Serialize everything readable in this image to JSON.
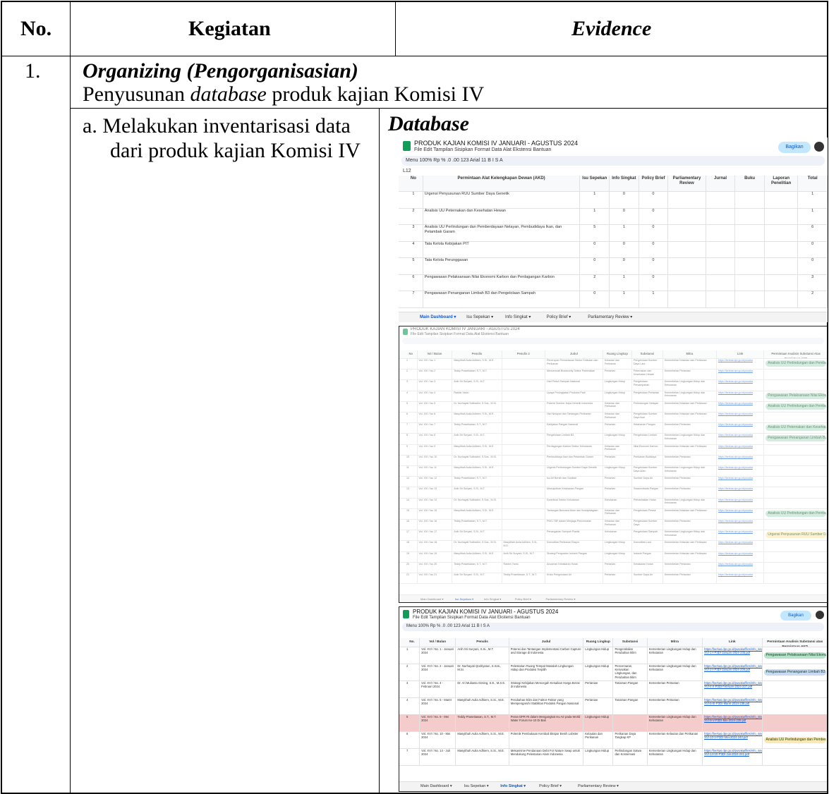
{
  "table": {
    "headers": {
      "no": "No.",
      "kegiatan": "Kegiatan",
      "evidence": "Evidence"
    },
    "row1": {
      "no": "1.",
      "title": "Organizing (Pengorganisasian)",
      "subtitle_pre": "Penyusunan ",
      "subtitle_em": "database",
      "subtitle_post": " produk kajian Komisi IV"
    },
    "item_a": {
      "line1": "a. Melakukan inventarisasi data",
      "line2": "dari produk kajian Komisi IV",
      "evidence_title": "Database"
    }
  },
  "spreadsheet": {
    "doc_title": "PRODUK KAJIAN KOMISI IV JANUARI - AGUSTUS 2024",
    "menu": "File  Edit  Tampilan  Sisipkan  Format  Data  Alat  Ekstensi  Bantuan",
    "toolbar": "Menu    100%    Rp  %  .0  .00  123    Arial    11    B  I  S  A",
    "share_label": "Bagikan",
    "cell_ref": "L12",
    "tabs": [
      "Main Dashboard",
      "Isu Sepekan",
      "Info Singkat",
      "Policy Brief",
      "Parliamentary Review"
    ],
    "dashboard": {
      "columns": [
        "No",
        "Permintaan Alat Kelengkapan Dewan (AKD)",
        "Isu Sepekan",
        "Info Singkat",
        "Policy Brief",
        "Parliamentary Review",
        "Jurnal",
        "Buku",
        "Laporan Penelitian",
        "Total"
      ],
      "rows": [
        [
          "1",
          "Urgensi Penyusunan RUU Sumber Daya Genetik",
          "1",
          "0",
          "0",
          "",
          "",
          "",
          "",
          "1"
        ],
        [
          "2",
          "Analisis UU Peternakan dan Kesehatan Hewan",
          "1",
          "0",
          "0",
          "",
          "",
          "",
          "",
          "1"
        ],
        [
          "3",
          "Analisis UU Perlindungan dan Pemberdayaan Nelayan, Pembudidaya Ikan, dan Petambak Garam",
          "5",
          "1",
          "0",
          "",
          "",
          "",
          "",
          "6"
        ],
        [
          "4",
          "Tata Kelola Kebijakan PIT",
          "0",
          "0",
          "0",
          "",
          "",
          "",
          "",
          "0"
        ],
        [
          "5",
          "Tata Kelola Perunggasan",
          "0",
          "0",
          "0",
          "",
          "",
          "",
          "",
          "0"
        ],
        [
          "6",
          "Pengawasan Pelaksanaan Nilai Ekonomi Karbon dan Perdagangan Karbon",
          "2",
          "1",
          "0",
          "",
          "",
          "",
          "",
          "3"
        ],
        [
          "7",
          "Pengawasan Penanganan Limbah B3 dan Pengelolaan Sampah",
          "0",
          "1",
          "1",
          "",
          "",
          "",
          "",
          "2"
        ]
      ]
    },
    "isu": {
      "columns": [
        "No",
        "Vol / Bulan",
        "Penulis",
        "Penulis 2",
        "Judul",
        "Ruang Lingkup",
        "Substansi",
        "Mitra",
        "Link",
        "Permintaan Analisis Substansi Atas Permintaan AKD"
      ],
      "rows": [
        [
          "1",
          "Vol. XVI / Isu 1",
          "Masyithah Aulia Adhiem, S.Si., M.E.",
          "",
          "Penerapan Pemantauan Sektor Kelautan dan Perikanan",
          "Kelautan dan Perikanan",
          "Pengelolaan Sumber Daya Laut",
          "Kementerian Kelautan dan Perikanan",
          "https://berkas.dpr.go.id/pusaka",
          "Analisis UU Perlindungan dan Pemberdayaan"
        ],
        [
          "2",
          "Vol. XVI / Isu 2",
          "Teddy Prasetiawan, S.T., M.T.",
          "",
          "Mencermati Biosecurity Sektor Peternakan",
          "Pertanian",
          "Peternakan dan Kesehatan Hewan",
          "Kementerian Pertanian",
          "https://berkas.dpr.go.id/pusaka",
          ""
        ],
        [
          "3",
          "Vol. XVI / Isu 3",
          "Anih Sri Suryani, S.Si., M.T.",
          "",
          "Hari Peduli Sampah Nasional",
          "Lingkungan Hidup",
          "Pengelolaan Persampahan",
          "Kementerian Lingkungan Hidup dan Kehutanan",
          "https://berkas.dpr.go.id/pusaka",
          ""
        ],
        [
          "4",
          "Vol. XVI / Isu 4",
          "Rasbin Yanto",
          "",
          "Upaya Peningkatan Produksi Padi",
          "Lingkungan Hidup",
          "Pengelolaan Pertanian",
          "Kementerian Lingkungan Hidup dan Kehutanan",
          "https://berkas.dpr.go.id/pusaka",
          "Pengawasan Pelaksanaan Nilai Ekonomi"
        ],
        [
          "5",
          "Vol. XVI / Isu 5",
          "Dr. Nurhayati Solihadini, S.Sos., M.Si.",
          "",
          "Potensi Sumber Daya Genetik Indonesia",
          "Kelautan dan Perikanan",
          "Perlindungan Nelayan",
          "Kementerian Kelautan dan Perikanan",
          "https://berkas.dpr.go.id/pusaka",
          "Analisis UU Perlindungan dan Pemberdayaan"
        ],
        [
          "6",
          "Vol. XVI / Isu 6",
          "Masyithah Aulia Adhiem, S.Si., M.E.",
          "",
          "Hari Nelayan dan Tantangan Perikanan",
          "Kelautan dan Perikanan",
          "Pengelolaan Sumber Daya Ikan",
          "Kementerian Kelautan dan Perikanan",
          "https://berkas.dpr.go.id/pusaka",
          ""
        ],
        [
          "7",
          "Vol. XVI / Isu 7",
          "Teddy Prasetiawan, S.T., M.T.",
          "",
          "Kebijakan Pangan Nasional",
          "Pertanian",
          "Ketahanan Pangan",
          "Kementerian Pertanian",
          "https://berkas.dpr.go.id/pusaka",
          "Analisis UU Peternakan dan Kesehatan"
        ],
        [
          "8",
          "Vol. XVI / Isu 8",
          "Anih Sri Suryani, S.Si., M.T.",
          "",
          "Pengelolaan Limbah B3",
          "Lingkungan Hidup",
          "Pengelolaan Limbah",
          "Kementerian Lingkungan Hidup dan Kehutanan",
          "https://berkas.dpr.go.id/pusaka",
          "Pengawasan Penanganan Limbah B3"
        ],
        [
          "9",
          "Vol. XVI / Isu 9",
          "Masyithah Aulia Adhiem, S.Si., M.E.",
          "",
          "Perdagangan Karbon Sektor Kehutanan",
          "Kelautan dan Perikanan",
          "Nilai Ekonomi Karbon",
          "Kementerian Kelautan dan Perikanan",
          "https://berkas.dpr.go.id/pusaka",
          ""
        ],
        [
          "10",
          "Vol. XVI / Isu 10",
          "Dr. Nurhayati Solihadini, S.Sos., M.Si.",
          "",
          "Pembudidaya Ikan dan Petambak Garam",
          "Pertanian",
          "Perikanan Budidaya",
          "Kementerian Pertanian",
          "https://berkas.dpr.go.id/pusaka",
          ""
        ],
        [
          "11",
          "Vol. XVI / Isu 11",
          "Masyithah Aulia Adhiem, S.Si., M.E.",
          "",
          "Urgensi Perlindungan Sumber Daya Genetik",
          "Lingkungan Hidup",
          "Pengelolaan Sumber Daya Alam",
          "Kementerian Lingkungan Hidup dan Kehutanan",
          "https://berkas.dpr.go.id/pusaka",
          ""
        ],
        [
          "12",
          "Vol. XVI / Isu 12",
          "Teddy Prasetiawan, S.T., M.T.",
          "",
          "Isu Air Bersih dan Sanitasi",
          "Pertanian",
          "Sumber Daya Air",
          "Kementerian Pertanian",
          "https://berkas.dpr.go.id/pusaka",
          ""
        ],
        [
          "13",
          "Vol. XVI / Isu 13",
          "Anih Sri Suryani, S.Si., M.T.",
          "",
          "Mewujudkan Ketahanan Pangan",
          "Pertanian",
          "Swasembada Pangan",
          "Kementerian Pertanian",
          "https://berkas.dpr.go.id/pusaka",
          ""
        ],
        [
          "14",
          "Vol. XVI / Isu 14",
          "Dr. Nurhayati Solihadini, S.Sos., M.Si.",
          "",
          "Kontribusi Sektor Kehutanan",
          "Kehutanan",
          "Pemanfaatan Hutan",
          "Kementerian Lingkungan Hidup dan Kehutanan",
          "https://berkas.dpr.go.id/pusaka",
          ""
        ],
        [
          "15",
          "Vol. XVI / Isu 15",
          "Masyithah Aulia Adhiem, S.Si., M.E.",
          "",
          "Tantangan Bencana Alam dan Kesiapsiagaan",
          "Kelautan dan Perikanan",
          "Pengelolaan Pesisir",
          "Kementerian Kelautan dan Perikanan",
          "https://berkas.dpr.go.id/pusaka",
          "Analisis UU Perlindungan dan Pemberdayaan"
        ],
        [
          "16",
          "Vol. XVI / Isu 16",
          "Teddy Prasetiawan, S.T., M.T.",
          "",
          "PMO-TBF dalam Menjaga Pencemaran",
          "Kelautan dan Perikanan",
          "Pengelolaan Sumber Daya",
          "Kementerian Pertanian",
          "https://berkas.dpr.go.id/pusaka",
          ""
        ],
        [
          "17",
          "Vol. XVI / Isu 17",
          "Anih Sri Suryani, S.Si., M.T.",
          "",
          "Penanganan Sampah Plastik",
          "Kehutanan",
          "Pengelolaan Sampah",
          "Kementerian Lingkungan Hidup dan Kehutanan",
          "https://berkas.dpr.go.id/pusaka",
          "Urgensi Penyusunan RUU Sumber Daya"
        ],
        [
          "18",
          "Vol. XVI / Isu 18",
          "Dr. Nurhayati Solihadini, S.Sos., M.Si.",
          "Masyithah Aulia Adhiem, S.Si., M.E.",
          "Komoditas Perikanan Ekspor",
          "Lingkungan Hidup",
          "Komoditas Laut",
          "Kementerian Kelautan dan Perikanan",
          "https://berkas.dpr.go.id/pusaka",
          ""
        ],
        [
          "19",
          "Vol. XVI / Isu 19",
          "Masyithah Aulia Adhiem, S.Si., M.E.",
          "Anih Sri Suryani, S.Si., M.T.",
          "Strategi Penguatan Industri Pangan",
          "Lingkungan Hidup",
          "Industri Pangan",
          "Kementerian Kelautan dan Perikanan",
          "https://berkas.dpr.go.id/pusaka",
          ""
        ],
        [
          "20",
          "Vol. XVI / Isu 20",
          "Teddy Prasetiawan, S.T., M.T.",
          "Rasbin Yanto",
          "Ancaman Kebakaran Hutan",
          "Pertanian",
          "Kebakaran Hutan",
          "Kementerian Pertanian",
          "https://berkas.dpr.go.id/pusaka",
          ""
        ],
        [
          "21",
          "Vol. XVI / Isu 21",
          "Anih Sri Suryani, S.Si., M.T.",
          "Teddy Prasetiawan, S.T., M.T.",
          "Krisis Pengelolaan Air",
          "Pertanian",
          "Sumber Daya Air",
          "Kementerian Pertanian",
          "https://berkas.dpr.go.id/pusaka",
          ""
        ]
      ]
    },
    "info": {
      "columns": [
        "No.",
        "Vol / Bulan",
        "Penulis",
        "Judul",
        "Ruang Lingkup",
        "Substansi",
        "Mitra",
        "Link",
        "Permintaan Analisis Substansi atas Permintaan AKD"
      ],
      "rows": [
        [
          "1",
          "Vol. XVI / No. 1 - Januari 2024",
          "Anih Sri Suryani, S.Si., M.T.",
          "Potensi dan Tantangan Implementasi Carbon Capture and Storage di Indonesia",
          "Lingkungan Hidup",
          "Pengendalian Perubahan Iklim",
          "Kementerian Lingkungan Hidup dan Kehutanan",
          "https://berkas.dpr.go.id/pusaka/files/info_singkat/Info%20Singkat-XVI-1-I-P3DI-Januari-2024-235.pdf",
          "Pengawasan Pelaksanaan Nilai Ekonomi Karbon"
        ],
        [
          "2",
          "Vol. XVI / No. 2 - Januari 2024",
          "Dr. Nurhayati Qodriyatun, S.Sos., M.Si.",
          "Pelestarian Ruang Tempat Masalah Lingkungan Hidup dan Produksi Terpilih",
          "Lingkungan Hidup",
          "Pencemaran, Kerusakan Lingkungan, dan Perubahan Iklim",
          "Kementerian Lingkungan Hidup dan Kehutanan",
          "https://berkas.dpr.go.id/pusaka/files/info_singkat/Info%20Singkat-XVI-2-I-P3DI-Januari-2024-236.pdf",
          "Pengawasan Penanganan Limbah B3 dan"
        ],
        [
          "3",
          "Vol. XVI / No. 4 - Februari 2024",
          "Dr. Ari Mulianta Ginting, S.E., M.S.E.",
          "Strategi Kebijakan Mencegah Kenaikan Harga Beras di Indonesia",
          "Pertanian",
          "Tanaman Pangan",
          "Kementerian Pertanian",
          "https://berkas.dpr.go.id/pusaka/files/info_singkat/Info%20Singkat-XVI-4-II-P3DI-Februari-2024-237.pdf",
          ""
        ],
        [
          "4",
          "Vol. XVI / No. 5 - Maret 2024",
          "Masyithah Aulia Adhiem, S.Si., M.E.",
          "Perubahan Iklim dan Faktor-Faktor yang Mempengaruhi Stabilitas Produksi Pangan Nasional",
          "Pertanian",
          "Tanaman Pangan",
          "Kementerian Pertanian",
          "https://berkas.dpr.go.id/pusaka/files/info_singkat/Info%20Singkat-XVI-5-III-P3DI-Maret-2024-238.pdf",
          ""
        ],
        [
          "5",
          "Vol. XVI / No. 9 - Mei 2024",
          "Teddy Prasetiawan, S.T., M.T.",
          "Peran DPR RI dalam Mengangkat Isu Air pada World Water Forum Ke-10 Di Bali",
          "Lingkungan Hidup",
          "",
          "Kementerian Lingkungan Hidup dan Kehutanan",
          "https://berkas.dpr.go.id/pusaka/files/info_singkat/Info%20Singkat-XVI-9-V-P3DI-Mei-2024-239.pdf",
          ""
        ],
        [
          "6",
          "Vol. XVI / No. 10 - Mei 2024",
          "Masyithah Aulia Adhiem, S.Si., M.E.",
          "Polemik Pembukaan Kembali Ekspor Benih Lobster",
          "Kelautan dan Perikanan",
          "Perikanan Daya Tangkap KP",
          "Kementerian Kelautan dan Perikanan",
          "https://berkas.dpr.go.id/pusaka/files/info_singkat/Info%20Singkat-XVI-10-V-P3DI-Mei-2024-240.pdf",
          "Analisis UU Perlindungan dan Pemberdayaan"
        ],
        [
          "7",
          "Vol. XVI / No. 14 - Juli 2024",
          "Masyithah Aulia Adhiem, S.Si., M.E.",
          "Mekanisme Pendanaan Debt For Nature Swap untuk Mendukung Pelestarian Alam Indonesia",
          "Lingkungan Hidup",
          "Perlindungan Satwa dan Konservasi",
          "Kementerian Lingkungan Hidup dan Kehutanan",
          "https://berkas.dpr.go.id/pusaka/files/info_singkat/Info%20Singkat-XVI-14-VII-P3DI-Juli-2024-241.pdf",
          ""
        ]
      ]
    },
    "colors": {
      "accent": "#0b57d0",
      "share_bg": "#c2e7ff",
      "highlight_row": "#f4cccc",
      "pill_green": "#b7e1cd",
      "pill_blue": "#c9daf8",
      "pill_yellow": "#fce8b2",
      "sheets_green": "#0f9d58"
    }
  }
}
